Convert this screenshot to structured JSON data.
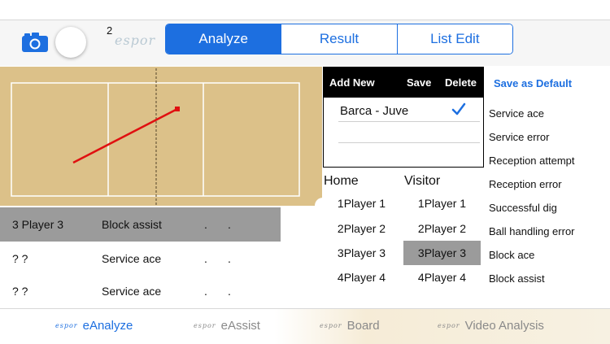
{
  "colors": {
    "accent": "#1d6fe0",
    "court": "#dcc189",
    "selected_row": "#9b9b9b",
    "trajectory": "#e01010"
  },
  "toolbar": {
    "badge_number": "2",
    "brand": "espor",
    "segments": [
      {
        "label": "Analyze",
        "active": true
      },
      {
        "label": "Result",
        "active": false
      },
      {
        "label": "List Edit",
        "active": false
      }
    ]
  },
  "events": [
    {
      "player": "3 Player 3",
      "action": "Block assist",
      "a": ".",
      "b": ".",
      "selected": true
    },
    {
      "player": "? ?",
      "action": "Service ace",
      "a": ".",
      "b": ".",
      "selected": false
    },
    {
      "player": "? ?",
      "action": "Service ace",
      "a": ".",
      "b": ".",
      "selected": false
    }
  ],
  "match_panel": {
    "add_new": "Add New",
    "save": "Save",
    "delete": "Delete",
    "matches": [
      {
        "name": "Barca - Juve",
        "checked": true
      }
    ]
  },
  "teams": {
    "home": {
      "title": "Home",
      "players": [
        {
          "label": "1Player 1"
        },
        {
          "label": "2Player 2"
        },
        {
          "label": "3Player 3"
        },
        {
          "label": "4Player 4"
        }
      ]
    },
    "visitor": {
      "title": "Visitor",
      "players": [
        {
          "label": "1Player 1"
        },
        {
          "label": "2Player 2"
        },
        {
          "label": "3Player 3",
          "selected": true
        },
        {
          "label": "4Player 4"
        }
      ]
    }
  },
  "actions": {
    "save_default": "Save as Default",
    "items": [
      "Service ace",
      "Service error",
      "Reception attempt",
      "Reception error",
      "Successful dig",
      "Ball handling error",
      "Block ace",
      "Block assist"
    ]
  },
  "tabs": [
    {
      "brand": "espor",
      "label": "eAnalyze",
      "active": true
    },
    {
      "brand": "espor",
      "label": "eAssist",
      "active": false
    },
    {
      "brand": "espor",
      "label": "Board",
      "active": false
    },
    {
      "brand": "espor",
      "label": "Video Analysis",
      "active": false
    }
  ]
}
